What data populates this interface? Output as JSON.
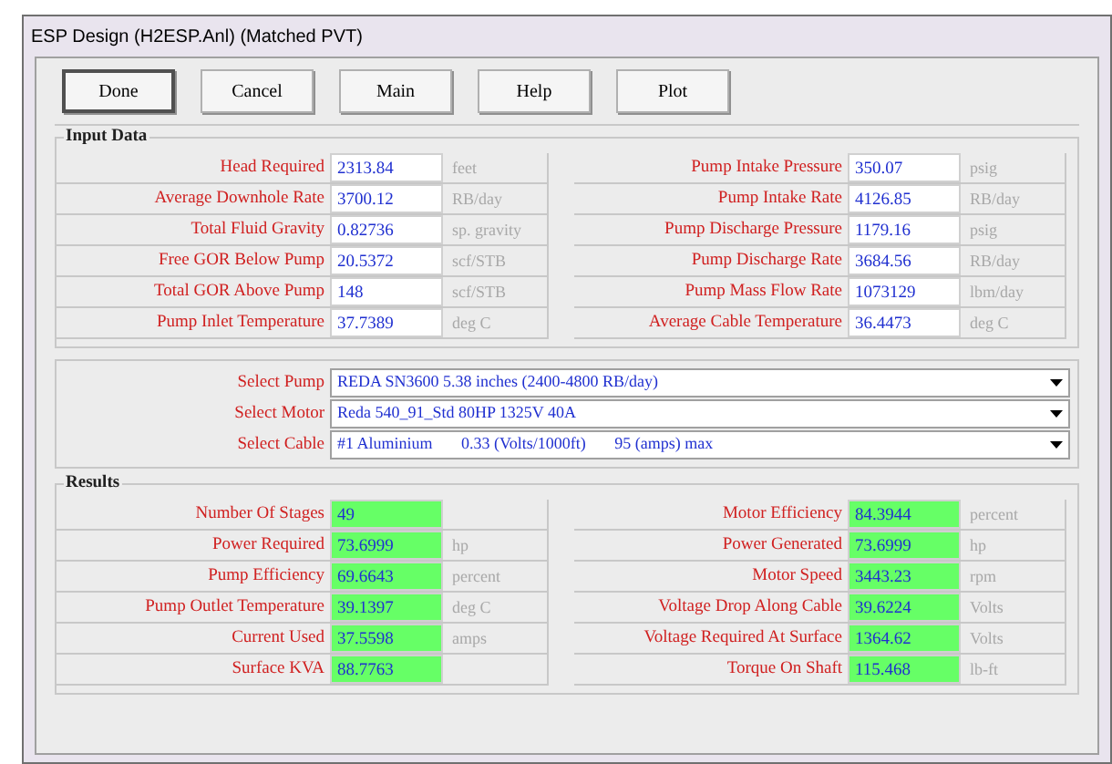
{
  "window": {
    "title": "ESP Design (H2ESP.Anl) (Matched PVT)"
  },
  "buttons": [
    {
      "label": "Done",
      "default": true
    },
    {
      "label": "Cancel",
      "default": false
    },
    {
      "label": "Main",
      "default": false
    },
    {
      "label": "Help",
      "default": false
    },
    {
      "label": "Plot",
      "default": false
    }
  ],
  "input_data": {
    "title": "Input Data",
    "left": [
      {
        "label": "Head Required",
        "value": "2313.84",
        "unit": "feet"
      },
      {
        "label": "Average Downhole Rate",
        "value": "3700.12",
        "unit": "RB/day"
      },
      {
        "label": "Total Fluid Gravity",
        "value": "0.82736",
        "unit": "sp. gravity"
      },
      {
        "label": "Free GOR Below Pump",
        "value": "20.5372",
        "unit": "scf/STB"
      },
      {
        "label": "Total GOR Above Pump",
        "value": "148",
        "unit": "scf/STB"
      },
      {
        "label": "Pump Inlet Temperature",
        "value": "37.7389",
        "unit": "deg C"
      }
    ],
    "right": [
      {
        "label": "Pump Intake Pressure",
        "value": "350.07",
        "unit": "psig"
      },
      {
        "label": "Pump Intake Rate",
        "value": "4126.85",
        "unit": "RB/day"
      },
      {
        "label": "Pump Discharge Pressure",
        "value": "1179.16",
        "unit": "psig"
      },
      {
        "label": "Pump Discharge Rate",
        "value": "3684.56",
        "unit": "RB/day"
      },
      {
        "label": "Pump Mass Flow Rate",
        "value": "1073129",
        "unit": "lbm/day"
      },
      {
        "label": "Average Cable Temperature",
        "value": "36.4473",
        "unit": "deg C"
      }
    ]
  },
  "selections": [
    {
      "label": "Select Pump",
      "value": "REDA SN3600 5.38 inches (2400-4800 RB/day)"
    },
    {
      "label": "Select Motor",
      "value": "Reda 540_91_Std 80HP 1325V 40A"
    },
    {
      "label": "Select Cable",
      "value": "#1 Aluminium       0.33 (Volts/1000ft)       95 (amps) max"
    }
  ],
  "results": {
    "title": "Results",
    "left": [
      {
        "label": "Number Of Stages",
        "value": "49"
      },
      {
        "label": "Power Required",
        "value": "73.6999",
        "unit": "hp"
      },
      {
        "label": "Pump Efficiency",
        "value": "69.6643",
        "unit": "percent"
      },
      {
        "label": "Pump Outlet Temperature",
        "value": "39.1397",
        "unit": "deg C"
      },
      {
        "label": "Current Used",
        "value": "37.5598",
        "unit": "amps"
      },
      {
        "label": "Surface KVA",
        "value": "88.7763"
      }
    ],
    "right": [
      {
        "label": "Motor Efficiency",
        "value": "84.3944",
        "unit": "percent"
      },
      {
        "label": "Power Generated",
        "value": "73.6999",
        "unit": "hp"
      },
      {
        "label": "Motor Speed",
        "value": "3443.23",
        "unit": "rpm"
      },
      {
        "label": "Voltage Drop Along Cable",
        "value": "39.6224",
        "unit": "Volts"
      },
      {
        "label": "Voltage Required At Surface",
        "value": "1364.62",
        "unit": "Volts"
      },
      {
        "label": "Torque On Shaft",
        "value": "115.468",
        "unit": "lb-ft"
      }
    ]
  }
}
